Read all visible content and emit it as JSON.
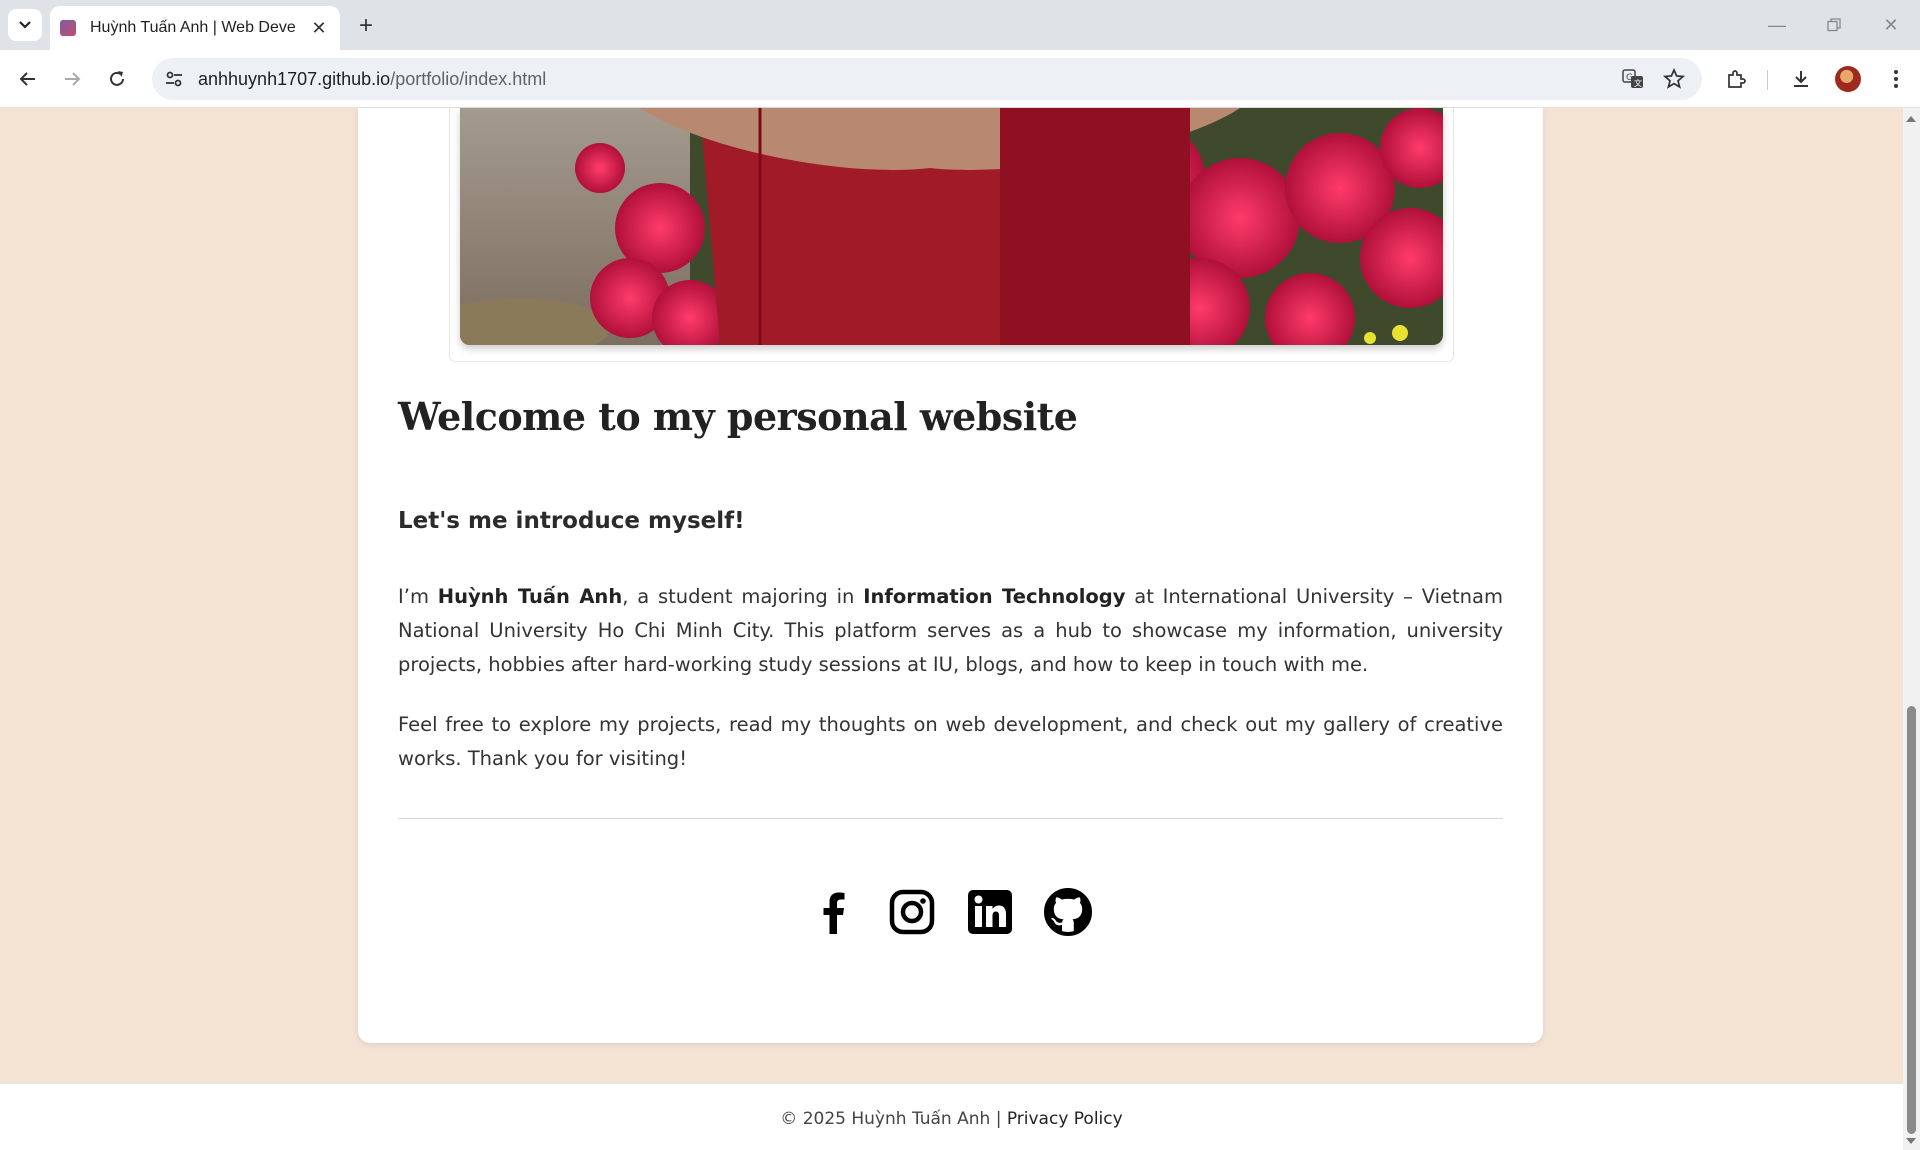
{
  "browser": {
    "tab_title": "Huỳnh Tuấn Anh | Web Developer",
    "url_host": "anhhuynh1707.github.io",
    "url_path": "/portfolio/index.html"
  },
  "page": {
    "heading": "Welcome to my personal website",
    "subheading": "Let's me introduce myself!",
    "intro": {
      "prefix": "I’m ",
      "name": "Huỳnh Tuấn Anh",
      "middle": ", a student majoring in ",
      "major": "Information Technology",
      "rest": " at International University – Vietnam National University Ho Chi Minh City. This platform serves as a hub to showcase my information, university projects, hobbies after hard-working study sessions at IU, blogs, and how to keep in touch with me."
    },
    "explore": "Feel free to explore my projects, read my thoughts on web development, and check out my gallery of creative works. Thank you for visiting!",
    "social": [
      "facebook-icon",
      "instagram-icon",
      "linkedin-icon",
      "github-icon"
    ]
  },
  "footer": {
    "copyright": "© 2025 Huỳnh Tuấn Anh | ",
    "privacy": "Privacy Policy"
  },
  "colors": {
    "page_bg": "#f4e2d3",
    "card_bg": "#ffffff",
    "text": "#333333"
  }
}
